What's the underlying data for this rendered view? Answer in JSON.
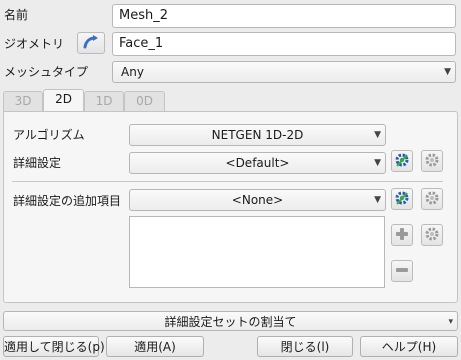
{
  "name_row": {
    "label": "名前",
    "value": "Mesh_2"
  },
  "geometry_row": {
    "label": "ジオメトリ",
    "value": "Face_1",
    "select_icon": "arrow-select-icon"
  },
  "mesh_type_row": {
    "label": "メッシュタイプ",
    "value": "Any"
  },
  "tabs": [
    {
      "label": "3D",
      "active": false
    },
    {
      "label": "2D",
      "active": true
    },
    {
      "label": "1D",
      "active": false
    },
    {
      "label": "0D",
      "active": false
    }
  ],
  "algorithm_row": {
    "label": "アルゴリズム",
    "value": "NETGEN 1D-2D"
  },
  "hypothesis_row": {
    "label": "詳細設定",
    "value": "<Default>",
    "edit_icon": "hypothesis-edit-icon",
    "new_icon": "hypothesis-new-icon"
  },
  "additional_row": {
    "label": "詳細設定の追加項目",
    "value": "<None>",
    "edit_icon": "hypothesis-edit-icon",
    "new_icon": "hypothesis-new-icon",
    "add_icon": "plus-icon",
    "remove_icon": "minus-icon",
    "list_items": []
  },
  "hypothesis_set_button": {
    "label": "詳細設定セットの割当て"
  },
  "footer": {
    "apply_close": "適用して閉じる(p)",
    "apply": "適用(A)",
    "close": "閉じる(l)",
    "help": "ヘルプ(H)"
  },
  "colors": {
    "window_bg": "#ececec",
    "panel_bg": "#f6f6f6",
    "select_icon_blue": "#3a70c0",
    "edit_icon_green": "#3aa84a",
    "edit_icon_blue": "#2a5ab0"
  }
}
